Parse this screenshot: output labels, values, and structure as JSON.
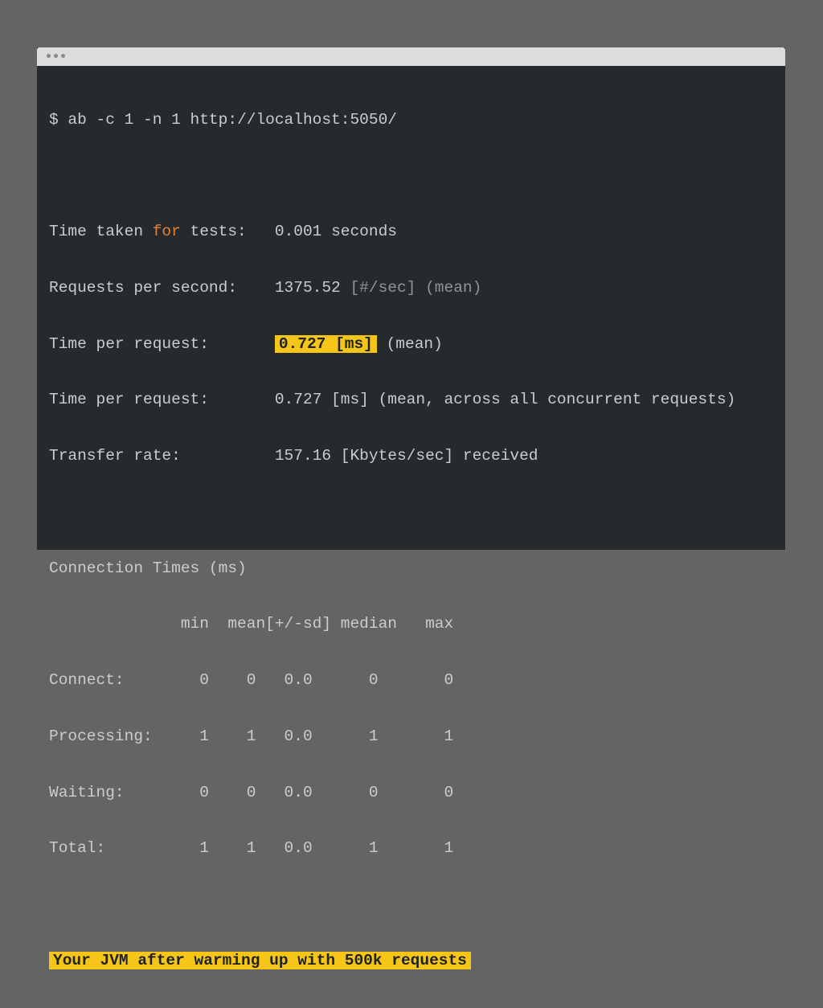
{
  "window": {
    "title_dots": [
      "dot",
      "dot",
      "dot"
    ]
  },
  "terminal": {
    "command": "$ ab -c 1 -n 1 http://localhost:5050/",
    "stats": {
      "time_taken_pre": "Time taken ",
      "time_taken_kw": "for",
      "time_taken_post": " tests:   0.001 seconds",
      "rps_label": "Requests per second:    1375.52 ",
      "rps_unit": "[#/sec] (mean)",
      "tpr1_label": "Time per request:       ",
      "tpr1_value": "0.727 [ms]",
      "tpr1_suffix": " (mean)",
      "tpr2": "Time per request:       0.727 [ms] (mean, across all concurrent requests)",
      "transfer": "Transfer rate:          157.16 [Kbytes/sec] received"
    },
    "connection_times": {
      "title": "Connection Times (ms)",
      "header": "              min  mean[+/-sd] median   max",
      "rows": [
        "Connect:        0    0   0.0      0       0",
        "Processing:     1    1   0.0      1       1",
        "Waiting:        0    0   0.0      0       0",
        "Total:          1    1   0.0      1       1"
      ]
    },
    "note": "Your JVM after warming up with 500k requests"
  }
}
